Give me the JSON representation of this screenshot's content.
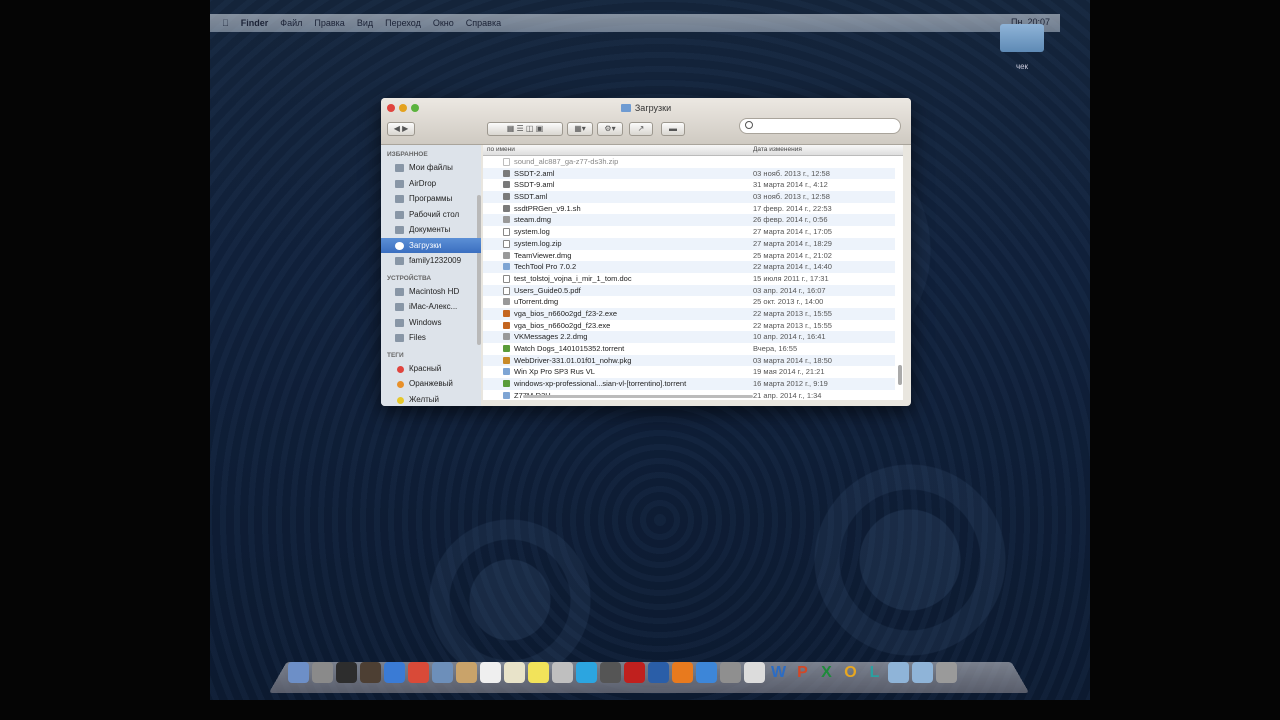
{
  "menubar": {
    "items": [
      "Finder",
      "Файл",
      "Правка",
      "Вид",
      "Переход",
      "Окно",
      "Справка"
    ],
    "clock": "Пн. 20:07"
  },
  "desktop": {
    "folder_label": "чек"
  },
  "window": {
    "title": "Загрузки"
  },
  "sidebar": {
    "favorites_header": "ИЗБРАННОЕ",
    "favorites": [
      "Мои файлы",
      "AirDrop",
      "Программы",
      "Рабочий стол",
      "Документы",
      "Загрузки",
      "family1232009"
    ],
    "devices_header": "УСТРОЙСТВА",
    "devices": [
      "Macintosh HD",
      "iMac-Алекс...",
      "Windows",
      "Files"
    ],
    "tags_header": "ТЕГИ",
    "tags": [
      {
        "label": "Красный",
        "color": "#e0443e"
      },
      {
        "label": "Оранжевый",
        "color": "#e8902a"
      },
      {
        "label": "Желтый",
        "color": "#e6c82a"
      }
    ]
  },
  "columns": {
    "name": "по имени",
    "date": "Дата изменения"
  },
  "files": [
    {
      "name": "sound_alc887_ga-z77-ds3h.zip",
      "date": "",
      "type": "doc"
    },
    {
      "name": "SSDT-2.aml",
      "date": "03 нояб. 2013 г., 12:58",
      "type": "file"
    },
    {
      "name": "SSDT-9.aml",
      "date": "31 марта 2014 г., 4:12",
      "type": "file"
    },
    {
      "name": "SSDT.aml",
      "date": "03 нояб. 2013 г., 12:58",
      "type": "file"
    },
    {
      "name": "ssdtPRGen_v9.1.sh",
      "date": "17 февр. 2014 г., 22:53",
      "type": "file"
    },
    {
      "name": "steam.dmg",
      "date": "26 февр. 2014 г., 0:56",
      "type": "dmg"
    },
    {
      "name": "system.log",
      "date": "27 марта 2014 г., 17:05",
      "type": "doc"
    },
    {
      "name": "system.log.zip",
      "date": "27 марта 2014 г., 18:29",
      "type": "doc"
    },
    {
      "name": "TeamViewer.dmg",
      "date": "25 марта 2014 г., 21:02",
      "type": "dmg"
    },
    {
      "name": "TechTool Pro 7.0.2",
      "date": "22 марта 2014 г., 14:40",
      "type": "folder"
    },
    {
      "name": "test_tolstoj_vojna_i_mir_1_tom.doc",
      "date": "15 июля 2011 г., 17:31",
      "type": "doc"
    },
    {
      "name": "Users_Guide0.5.pdf",
      "date": "03 апр. 2014 г., 16:07",
      "type": "doc"
    },
    {
      "name": "uTorrent.dmg",
      "date": "25 окт. 2013 г., 14:00",
      "type": "dmg"
    },
    {
      "name": "vga_bios_n660o2gd_f23-2.exe",
      "date": "22 марта 2013 г., 15:55",
      "type": "exe"
    },
    {
      "name": "vga_bios_n660o2gd_f23.exe",
      "date": "22 марта 2013 г., 15:55",
      "type": "exe"
    },
    {
      "name": "VKMessages 2.2.dmg",
      "date": "10 апр. 2014 г., 16:41",
      "type": "dmg"
    },
    {
      "name": "Watch Dogs_1401015352.torrent",
      "date": "Вчера, 16:55",
      "type": "torrent"
    },
    {
      "name": "WebDriver-331.01.01f01_nohw.pkg",
      "date": "03 марта 2014 г., 18:50",
      "type": "pkg"
    },
    {
      "name": "Win Xp Pro SP3 Rus VL",
      "date": "19 мая 2014 г., 21:21",
      "type": "folder"
    },
    {
      "name": "windows-xp-professional...sian-vl-[torrentino].torrent",
      "date": "16 марта 2012 г., 9:19",
      "type": "torrent"
    },
    {
      "name": "Z77M-D3H",
      "date": "21 апр. 2014 г., 1:34",
      "type": "folder"
    }
  ],
  "dock": {
    "icons": [
      {
        "name": "finder-icon",
        "color": "#6d8fc7"
      },
      {
        "name": "launchpad-icon",
        "color": "#8a8a8a"
      },
      {
        "name": "dashboard-icon",
        "color": "#2d2d2d"
      },
      {
        "name": "mission-control-icon",
        "color": "#4d3f33"
      },
      {
        "name": "safari-icon",
        "color": "#3a7bd5"
      },
      {
        "name": "chrome-icon",
        "color": "#d94a38"
      },
      {
        "name": "preview-icon",
        "color": "#6d8fba"
      },
      {
        "name": "contacts-icon",
        "color": "#c9a36a"
      },
      {
        "name": "calendar-icon",
        "color": "#efefef"
      },
      {
        "name": "notes-icon",
        "color": "#e8e3c9"
      },
      {
        "name": "stickies-icon",
        "color": "#f2e35a"
      },
      {
        "name": "photo-icon",
        "color": "#bfbfbf"
      },
      {
        "name": "skype-icon",
        "color": "#2ca5e0"
      },
      {
        "name": "facetime-icon",
        "color": "#555"
      },
      {
        "name": "red-app-icon",
        "color": "#c0201e"
      },
      {
        "name": "blue-app-icon",
        "color": "#2a5ea8"
      },
      {
        "name": "vlc-icon",
        "color": "#e87a1e"
      },
      {
        "name": "appstore-icon",
        "color": "#3d86d8"
      },
      {
        "name": "system-prefs-icon",
        "color": "#8f8f8f"
      },
      {
        "name": "textedit-icon",
        "color": "#dcdcdc"
      }
    ],
    "office_letters": [
      {
        "letter": "W",
        "color": "#2b6cc4"
      },
      {
        "letter": "P",
        "color": "#d24726"
      },
      {
        "letter": "X",
        "color": "#1e8a3a"
      },
      {
        "letter": "O",
        "color": "#e8a720"
      },
      {
        "letter": "L",
        "color": "#2aa0a0"
      }
    ]
  }
}
